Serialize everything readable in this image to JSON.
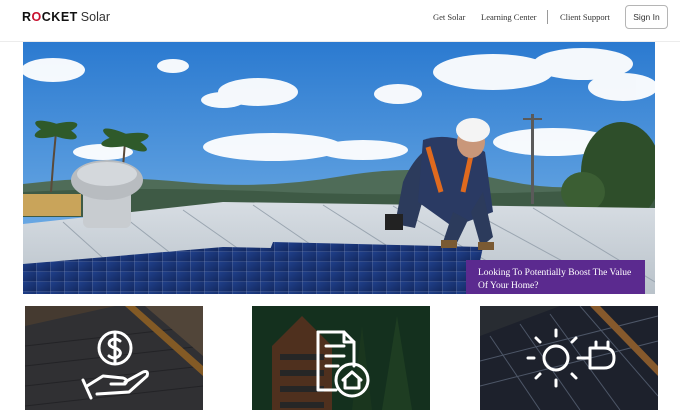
{
  "header": {
    "logo": {
      "brand_part1": "R",
      "brand_o": "O",
      "brand_part2": "CKET",
      "sub": "Solar"
    },
    "nav": {
      "get_solar": "Get Solar",
      "learning_center": "Learning Center",
      "client_support": "Client Support"
    },
    "sign_in": "Sign In"
  },
  "hero": {
    "caption": "Looking To Potentially Boost The Value Of Your Home?"
  },
  "cards": [
    {
      "icon": "dollar-hand-icon"
    },
    {
      "icon": "document-house-icon"
    },
    {
      "icon": "lightbulb-plug-icon"
    }
  ],
  "colors": {
    "brand_red": "#c8102e",
    "caption_purple": "#5b2a8f",
    "sky": "#2f7fd0"
  }
}
